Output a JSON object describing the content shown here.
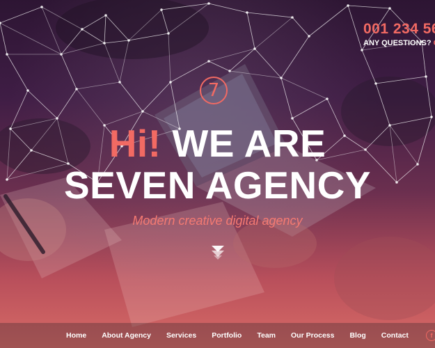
{
  "header": {
    "phone": "001 234 56",
    "question": "ANY QUESTIONS?",
    "call_prefix": "CA"
  },
  "logo": {
    "glyph": "7"
  },
  "hero": {
    "headline_hi": "Hi!",
    "headline_rest": "WE ARE",
    "headline_line2": "SEVEN AGENCY",
    "tagline": "Modern creative digital agency"
  },
  "nav": {
    "items": [
      {
        "label": "Home"
      },
      {
        "label": "About Agency"
      },
      {
        "label": "Services"
      },
      {
        "label": "Portfolio"
      },
      {
        "label": "Team"
      },
      {
        "label": "Our Process"
      },
      {
        "label": "Blog"
      },
      {
        "label": "Contact"
      }
    ]
  },
  "social": {
    "facebook_glyph": "f"
  },
  "colors": {
    "accent": "#f26a63",
    "text": "#ffffff"
  },
  "icons": {
    "scroll": "double-chevron-down-icon",
    "social": "facebook-icon",
    "logo": "seven-logo-icon"
  }
}
